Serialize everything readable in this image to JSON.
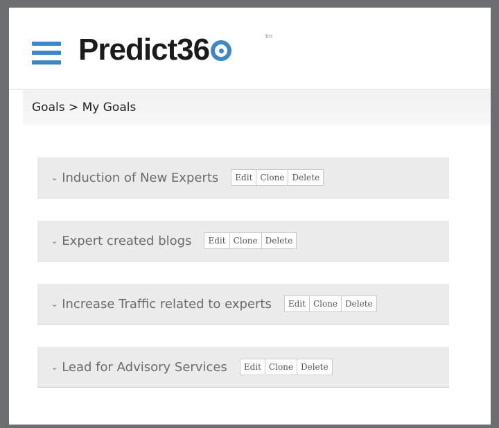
{
  "header": {
    "logo_text": "Predict36",
    "logo_tm": "tm"
  },
  "breadcrumb": "Goals > My Goals",
  "goals": [
    {
      "title": "Induction of New Experts"
    },
    {
      "title": "Expert created blogs"
    },
    {
      "title": "Increase Traffic related to experts"
    },
    {
      "title": "Lead for Advisory Services"
    }
  ],
  "actions": {
    "edit": "Edit",
    "clone": "Clone",
    "delete": "Delete"
  },
  "colors": {
    "accent": "#3d87c8",
    "row_bg": "#ebebeb",
    "frame_border": "#6d6e71"
  },
  "icons": {
    "menu": "hamburger-menu-icon",
    "expand": "chevron-down-icon"
  }
}
